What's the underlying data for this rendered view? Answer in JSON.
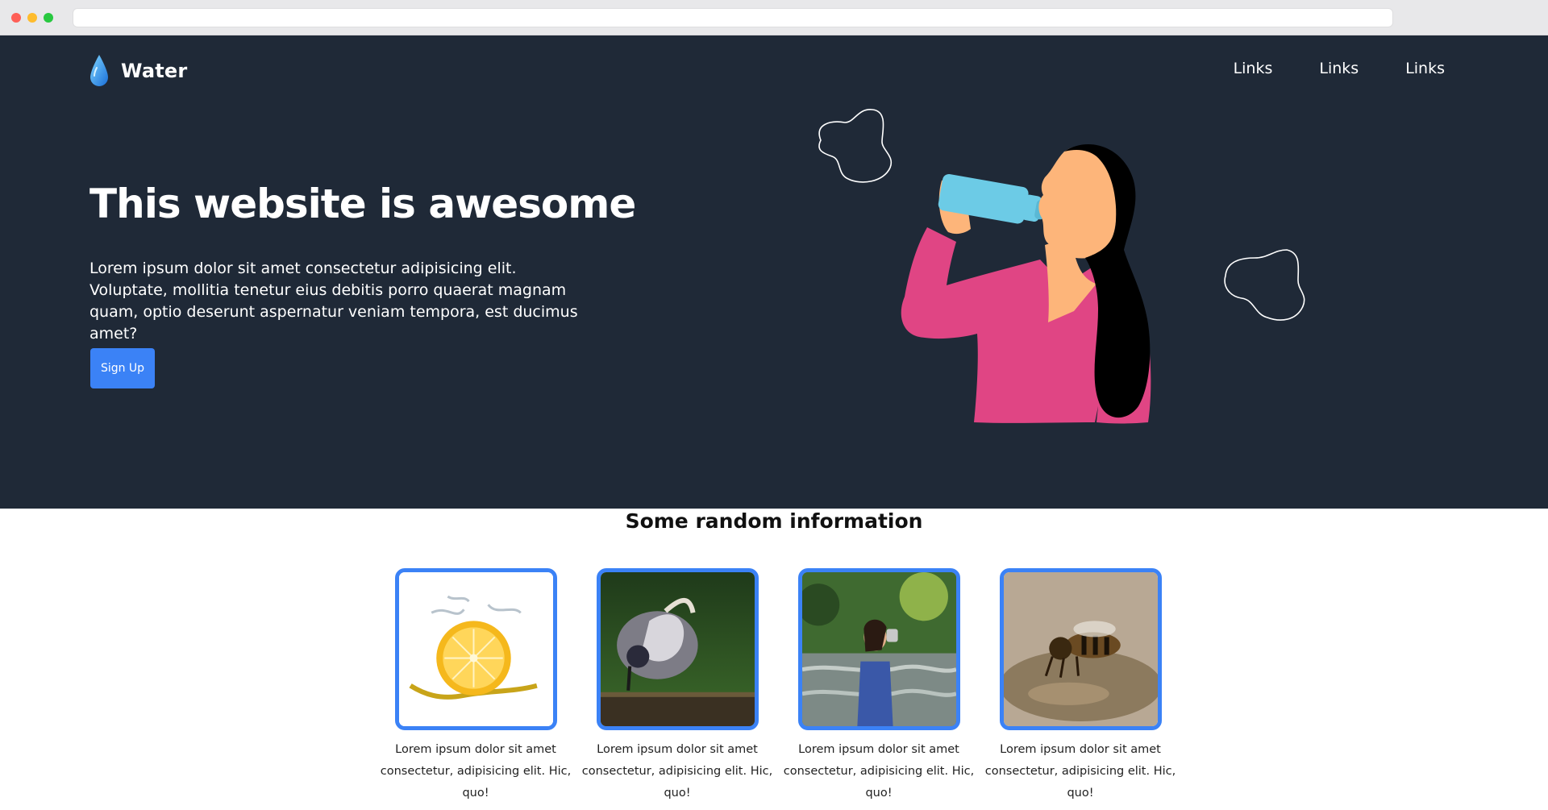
{
  "browser": {
    "url": ""
  },
  "brand": {
    "name": "Water",
    "icon": "water-drop-icon"
  },
  "nav": {
    "links": [
      "Links",
      "Links",
      "Links"
    ]
  },
  "hero": {
    "headline": "This website is awesome",
    "lead": "Lorem ipsum dolor sit amet consectetur adipisicing elit. Voluptate, mollitia tenetur eius debitis porro quaerat magnam quam, optio deserunt aspernatur veniam tempora, est ducimus amet?",
    "cta_label": "Sign Up"
  },
  "info": {
    "title": "Some random information",
    "cards": [
      {
        "image": "lemon-splash-image",
        "caption": "Lorem ipsum dolor sit amet consectetur, adipisicing elit. Hic, quo!"
      },
      {
        "image": "bird-drinking-image",
        "caption": "Lorem ipsum dolor sit amet consectetur, adipisicing elit. Hic, quo!"
      },
      {
        "image": "woman-drinking-river-image",
        "caption": "Lorem ipsum dolor sit amet consectetur, adipisicing elit. Hic, quo!"
      },
      {
        "image": "bee-drinking-image",
        "caption": "Lorem ipsum dolor sit amet consectetur, adipisicing elit. Hic, quo!"
      }
    ]
  },
  "colors": {
    "hero_bg": "#1f2937",
    "accent": "#3b82f6",
    "shirt": "#e04584",
    "bottle": "#6ccbe6",
    "skin": "#fdb57a"
  }
}
